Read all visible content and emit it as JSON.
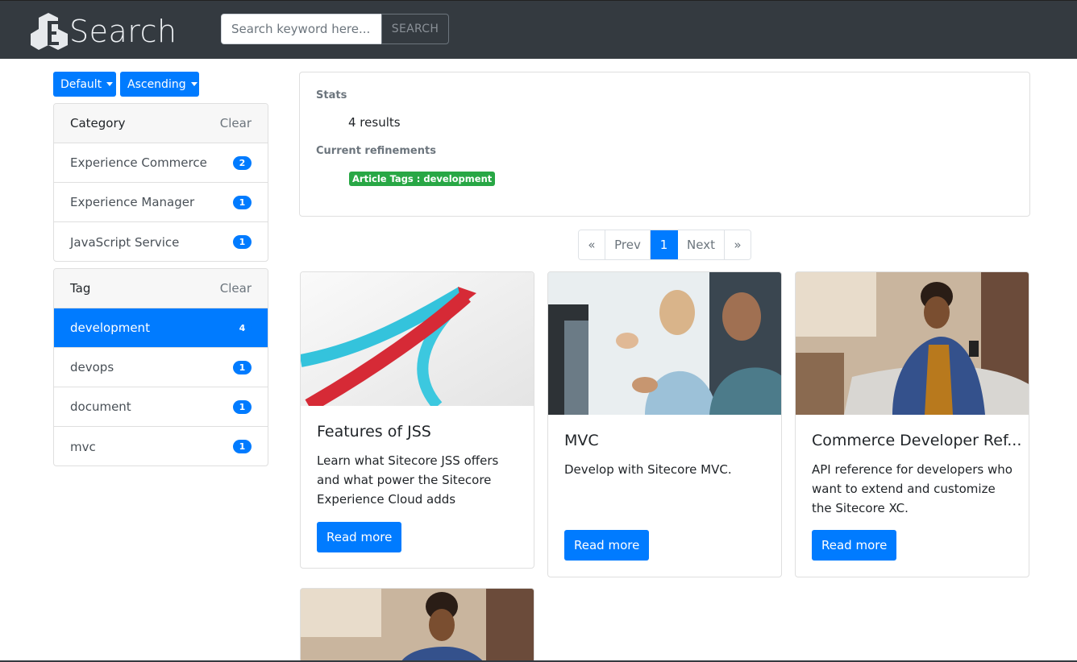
{
  "header": {
    "logo_text": "Search",
    "search_placeholder": "Search keyword here...",
    "search_button": "SEARCH"
  },
  "sort": {
    "field": "Default",
    "order": "Ascending"
  },
  "facets": {
    "category": {
      "title": "Category",
      "clear": "Clear",
      "items": [
        {
          "label": "Experience Commerce",
          "count": "2"
        },
        {
          "label": "Experience Manager",
          "count": "1"
        },
        {
          "label": "JavaScript Service",
          "count": "1"
        }
      ]
    },
    "tag": {
      "title": "Tag",
      "clear": "Clear",
      "items": [
        {
          "label": "development",
          "count": "4",
          "active": true
        },
        {
          "label": "devops",
          "count": "1"
        },
        {
          "label": "document",
          "count": "1"
        },
        {
          "label": "mvc",
          "count": "1"
        }
      ]
    }
  },
  "stats": {
    "stats_label": "Stats",
    "results": "4 results",
    "refinements_label": "Current refinements",
    "refinement_tag": "Article Tags : development"
  },
  "pagination": {
    "first": "«",
    "prev": "Prev",
    "current": "1",
    "next": "Next",
    "last": "»"
  },
  "cards": [
    {
      "title": "Features of JSS",
      "description": "Learn what Sitecore JSS offers and what power the Sitecore Experience Cloud adds",
      "button": "Read more"
    },
    {
      "title": "MVC",
      "description": "Develop with Sitecore MVC.",
      "button": "Read more"
    },
    {
      "title": "Commerce Developer Ref...",
      "description": "API reference for developers who want to extend and customize the Sitecore XC.",
      "button": "Read more"
    }
  ],
  "colors": {
    "primary": "#007bff",
    "header_bg": "#343a40",
    "success": "#28a745"
  }
}
